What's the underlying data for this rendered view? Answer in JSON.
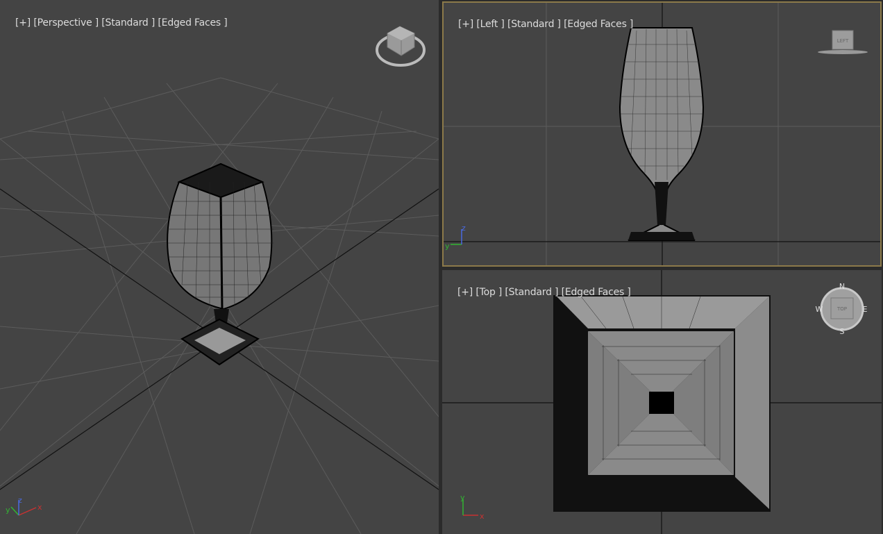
{
  "viewports": {
    "perspective": {
      "labels": [
        "[+]",
        "[Perspective ]",
        "[Standard ]",
        "[Edged Faces ]"
      ]
    },
    "left": {
      "labels": [
        "[+]",
        "[Left ]",
        "[Standard ]",
        "[Edged Faces ]"
      ],
      "viewcube_face": "LEFT"
    },
    "top": {
      "labels": [
        "[+]",
        "[Top ]",
        "[Standard ]",
        "[Edged Faces ]"
      ],
      "viewcube_face": "TOP",
      "compass": {
        "n": "N",
        "s": "S",
        "e": "E",
        "w": "W"
      }
    }
  },
  "axes": {
    "x": "x",
    "y": "y",
    "z": "z"
  },
  "colors": {
    "viewport_bg": "#444444",
    "active_border": "#8c7a4a",
    "grid": "#5a5a5a",
    "axis_x": "#c83232",
    "axis_y": "#32b432",
    "axis_z": "#4a6ae0"
  }
}
